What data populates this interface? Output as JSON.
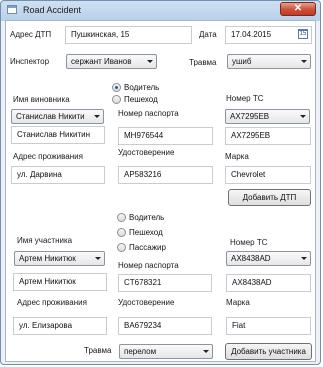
{
  "window": {
    "title": "Road Accident",
    "close_glyph": "✕"
  },
  "accident": {
    "address_label": "Адрес ДТП",
    "address_value": "Пушкинская, 15",
    "date_label": "Дата",
    "date_value": "17.04.2015",
    "calendar_icon_text": "15",
    "inspector_label": "Инспектор",
    "inspector_value": "сержант Иванов",
    "injury_label": "Травма",
    "injury_value": "ушиб"
  },
  "culprit": {
    "name_label": "Имя виновника",
    "name_combo": "Станислав Никити",
    "name_value": "Станислав Никитин",
    "role_options": [
      {
        "label": "Водитель",
        "checked": true
      },
      {
        "label": "Пешеход",
        "checked": false
      }
    ],
    "passport_label": "Номер паспорта",
    "passport_value": "MH976544",
    "plate_label": "Номер ТС",
    "plate_combo": "AX7295EB",
    "plate_value": "AX7295EB",
    "address_label": "Адрес проживания",
    "address_value": "ул. Дарвина",
    "license_label": "Удостоверение",
    "license_value": "AP583216",
    "brand_label": "Марка",
    "brand_value": "Chevrolet",
    "add_button": "Добавить ДТП"
  },
  "participant": {
    "role_options": [
      {
        "label": "Водитель",
        "checked": false
      },
      {
        "label": "Пешеход",
        "checked": false
      },
      {
        "label": "Пассажир",
        "checked": false
      }
    ],
    "name_label": "Имя участника",
    "name_combo": "Артем Никитюк",
    "name_value": "Артем Никитюк",
    "plate_label": "Номер ТС",
    "plate_combo": "AX8438AD",
    "plate_value": "AX8438AD",
    "passport_label": "Номер паспорта",
    "passport_value": "CT678321",
    "address_label": "Адрес проживания",
    "address_value": "ул. Елизарова",
    "license_label": "Удостоверение",
    "license_value": "BA679234",
    "brand_label": "Марка",
    "brand_value": "Fiat",
    "injury_label": "Травма",
    "injury_value": "перелом",
    "add_button": "Добавить участника"
  }
}
